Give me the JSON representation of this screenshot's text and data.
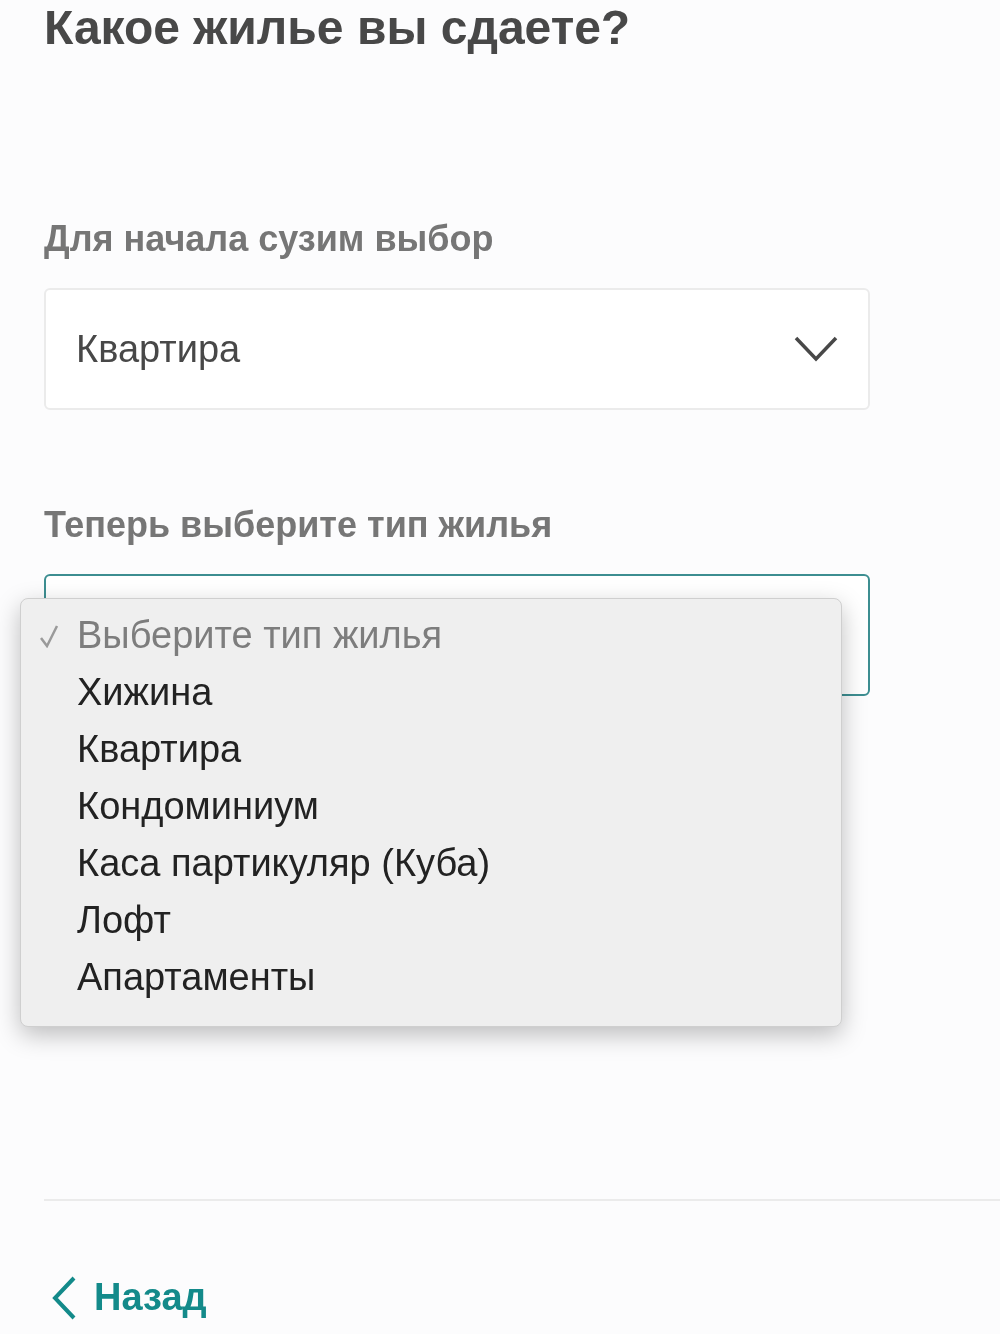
{
  "heading": "Какое жилье вы сдаете?",
  "category": {
    "label": "Для начала сузим выбор",
    "value": "Квартира"
  },
  "type_select": {
    "label": "Теперь выберите тип жилья",
    "expanded": true,
    "options": [
      {
        "label": "Выберите тип жилья",
        "selected": true,
        "disabled": true
      },
      {
        "label": "Хижина",
        "selected": false,
        "disabled": false
      },
      {
        "label": "Квартира",
        "selected": false,
        "disabled": false
      },
      {
        "label": "Кондоминиум",
        "selected": false,
        "disabled": false
      },
      {
        "label": "Каса партикуляр (Куба)",
        "selected": false,
        "disabled": false
      },
      {
        "label": "Лофт",
        "selected": false,
        "disabled": false
      },
      {
        "label": "Апартаменты",
        "selected": false,
        "disabled": false
      }
    ]
  },
  "back_link": "Назад"
}
